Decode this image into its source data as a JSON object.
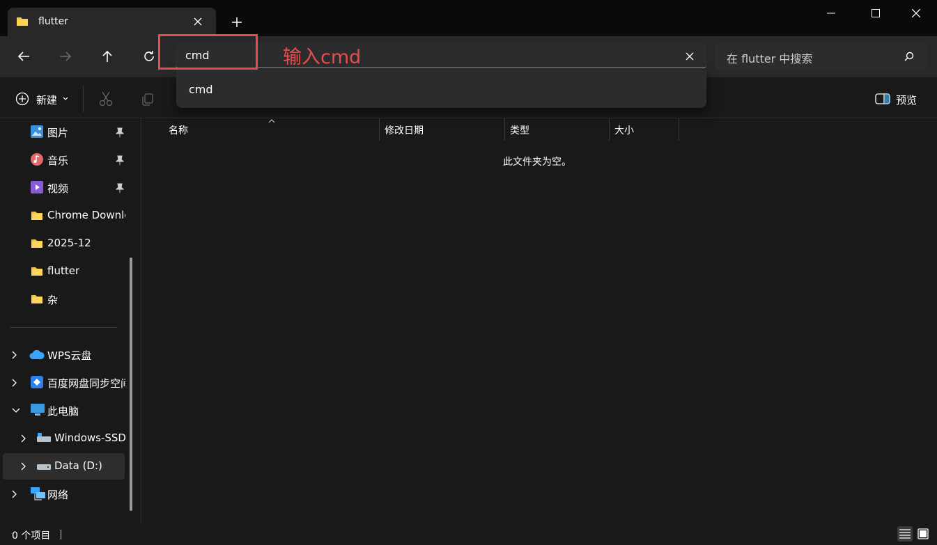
{
  "window": {
    "tab_title": "flutter",
    "new_tab_label": "+"
  },
  "nav": {
    "address_value": "cmd",
    "search_placeholder": "在 flutter 中搜索",
    "suggestion": "cmd",
    "annotation": "输入cmd"
  },
  "toolbar": {
    "new_label": "新建",
    "preview_label": "预览"
  },
  "sidebar": {
    "quick": [
      {
        "label": "图片",
        "icon": "pictures-icon",
        "pinned": true
      },
      {
        "label": "音乐",
        "icon": "music-icon",
        "pinned": true
      },
      {
        "label": "视频",
        "icon": "videos-icon",
        "pinned": true
      },
      {
        "label": "Chrome Downlo",
        "icon": "folder-icon",
        "pinned": false
      },
      {
        "label": "2025-12",
        "icon": "folder-icon",
        "pinned": false
      },
      {
        "label": "flutter",
        "icon": "folder-icon",
        "pinned": false
      },
      {
        "label": "杂",
        "icon": "folder-icon",
        "pinned": false
      }
    ],
    "tree": [
      {
        "label": "WPS云盘",
        "icon": "cloud-icon"
      },
      {
        "label": "百度网盘同步空间",
        "icon": "baidu-netdisk-icon"
      },
      {
        "label": "此电脑",
        "icon": "this-pc-icon"
      },
      {
        "label": "Windows-SSD",
        "icon": "drive-icon"
      },
      {
        "label": "Data (D:)",
        "icon": "drive-icon"
      },
      {
        "label": "网络",
        "icon": "network-icon"
      }
    ]
  },
  "columns": [
    "名称",
    "修改日期",
    "类型",
    "大小"
  ],
  "empty_message": "此文件夹为空。",
  "status": {
    "item_count": "0 个项目"
  },
  "colors": {
    "accent_annotation": "#e84c4c",
    "address_focus": "#76b96b"
  }
}
